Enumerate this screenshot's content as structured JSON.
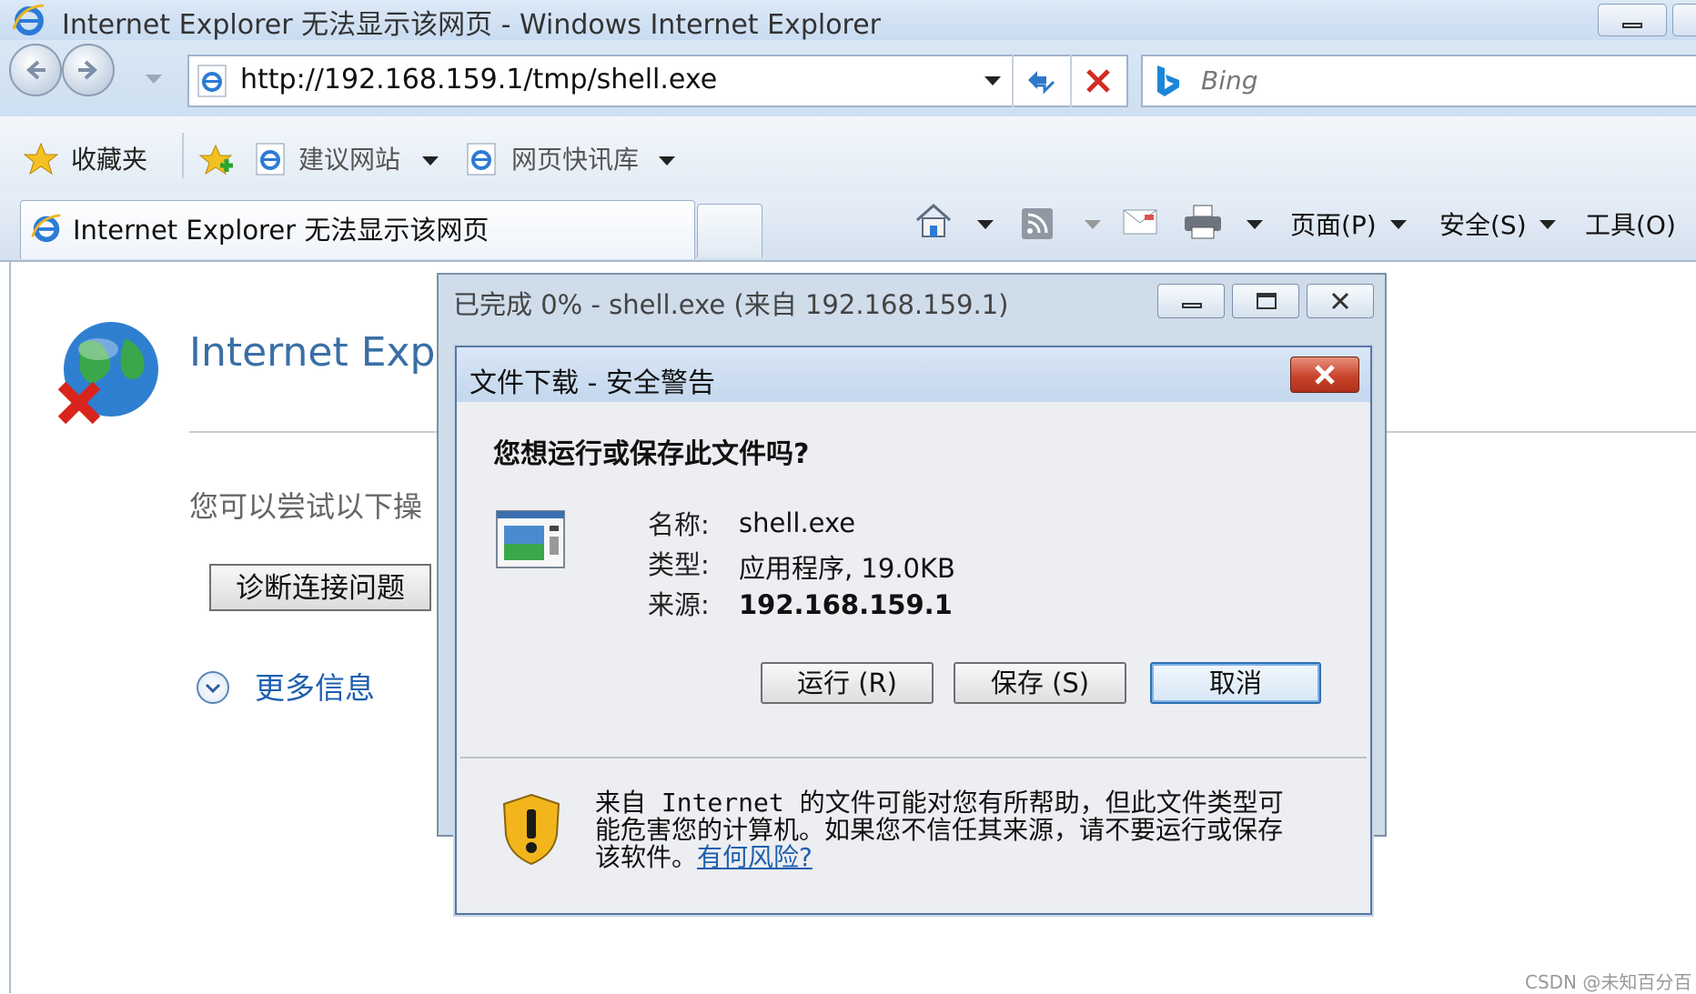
{
  "window": {
    "title": "Internet Explorer 无法显示该网页 - Windows Internet Explorer"
  },
  "address_bar": {
    "url": "http://192.168.159.1/tmp/shell.exe",
    "search_placeholder": "Bing"
  },
  "favorites_bar": {
    "favorites_label": "收藏夹",
    "items": [
      {
        "label": "建议网站"
      },
      {
        "label": "网页快讯库"
      }
    ]
  },
  "tabs": [
    {
      "label": "Internet Explorer 无法显示该网页"
    }
  ],
  "command_bar": {
    "page_menu": "页面(P)",
    "safety_menu": "安全(S)",
    "tools_menu": "工具(O)"
  },
  "error_page": {
    "heading": "Internet Expl",
    "try_text": "您可以尝试以下操",
    "diagnose_button": "诊断连接问题",
    "more_info": "更多信息"
  },
  "progress_dialog": {
    "title": "已完成 0% - shell.exe (来自 192.168.159.1)"
  },
  "security_dialog": {
    "title": "文件下载 - 安全警告",
    "question": "您想运行或保存此文件吗?",
    "name_label": "名称:",
    "name_value": "shell.exe",
    "type_label": "类型:",
    "type_value": "应用程序, 19.0KB",
    "source_label": "来源:",
    "source_value": "192.168.159.1",
    "run_button": "运行 (R)",
    "save_button": "保存 (S)",
    "cancel_button": "取消",
    "warning_text": "来自 Internet 的文件可能对您有所帮助，但此文件类型可能危害您的计算机。如果您不信任其来源，请不要运行或保存该软件。",
    "warning_link": "有何风险?"
  },
  "watermark": "CSDN @未知百分百",
  "colors": {
    "accent": "#3a6ea5",
    "link": "#1f5fae",
    "close_red": "#c8442b"
  }
}
